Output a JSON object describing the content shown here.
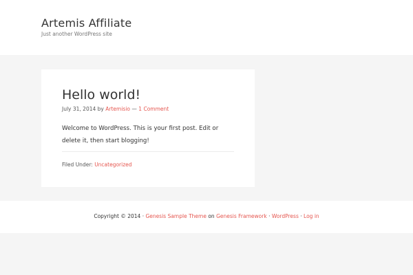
{
  "header": {
    "site_title": "Artemis Affiliate",
    "site_description": "Just another WordPress site"
  },
  "post": {
    "title": "Hello world!",
    "date": "July 31, 2014",
    "by": "by",
    "author": "Artemisio",
    "separator": "—",
    "comments": "1 Comment",
    "content": "Welcome to WordPress. This is your first post. Edit or delete it, then start blogging!",
    "filed_under_label": "Filed Under:",
    "category": "Uncategorized"
  },
  "footer": {
    "copyright": "Copyright © 2014 ·",
    "theme_link": "Genesis Sample Theme",
    "on": "on",
    "framework_link": "Genesis Framework",
    "sep1": "·",
    "wordpress_link": "WordPress",
    "sep2": "·",
    "login_link": "Log in"
  },
  "colors": {
    "link": "#e5554e",
    "background": "#f5f5f5",
    "surface": "#ffffff"
  }
}
